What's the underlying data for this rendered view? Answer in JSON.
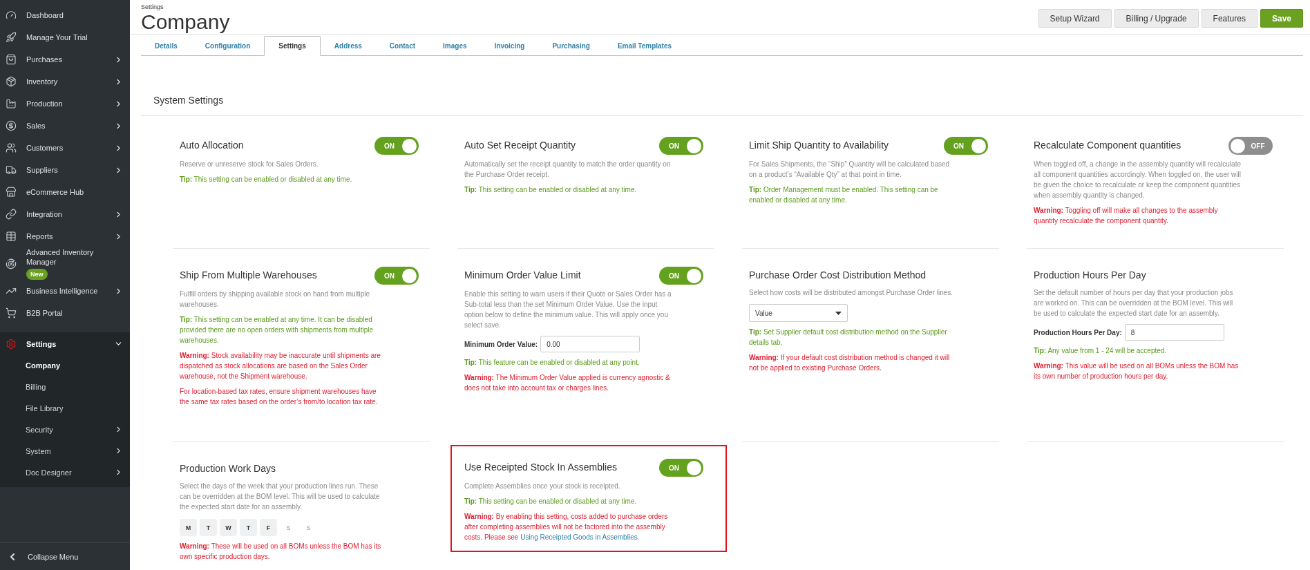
{
  "sidebar": {
    "items": [
      {
        "label": "Dashboard",
        "arrow": false,
        "expanded": false,
        "selected": false
      },
      {
        "label": "Manage Your Trial",
        "arrow": false,
        "expanded": false,
        "selected": false
      },
      {
        "label": "Purchases",
        "arrow": true,
        "expanded": false,
        "selected": false
      },
      {
        "label": "Inventory",
        "arrow": true,
        "expanded": false,
        "selected": false
      },
      {
        "label": "Production",
        "arrow": true,
        "expanded": false,
        "selected": false
      },
      {
        "label": "Sales",
        "arrow": true,
        "expanded": false,
        "selected": false
      },
      {
        "label": "Customers",
        "arrow": true,
        "expanded": false,
        "selected": false
      },
      {
        "label": "Suppliers",
        "arrow": true,
        "expanded": false,
        "selected": false
      },
      {
        "label": "eCommerce Hub",
        "arrow": false,
        "expanded": false,
        "selected": false
      },
      {
        "label": "Integration",
        "arrow": true,
        "expanded": false,
        "selected": false
      },
      {
        "label": "Reports",
        "arrow": true,
        "expanded": false,
        "selected": false
      },
      {
        "label": "Advanced Inventory Manager",
        "badge": "New",
        "arrow": false,
        "expanded": false,
        "selected": false
      },
      {
        "label": "Business Intelligence",
        "arrow": true,
        "expanded": false,
        "selected": false
      },
      {
        "label": "B2B Portal",
        "arrow": false,
        "expanded": false,
        "selected": false
      },
      {
        "label": "Settings",
        "arrow": true,
        "expanded": true,
        "selected": true,
        "children": [
          {
            "label": "Company",
            "arrow": false,
            "selected": true
          },
          {
            "label": "Billing",
            "arrow": false,
            "selected": false
          },
          {
            "label": "File Library",
            "arrow": false,
            "selected": false
          },
          {
            "label": "Security",
            "arrow": true,
            "selected": false
          },
          {
            "label": "System",
            "arrow": true,
            "selected": false
          },
          {
            "label": "Doc Designer",
            "arrow": true,
            "selected": false
          }
        ]
      }
    ],
    "collapse": "Collapse Menu"
  },
  "header": {
    "breadcrumb": "Settings",
    "title": "Company",
    "buttons": [
      {
        "label": "Setup Wizard",
        "kind": "default"
      },
      {
        "label": "Billing / Upgrade",
        "kind": "default"
      },
      {
        "label": "Features",
        "kind": "default"
      },
      {
        "label": "Save",
        "kind": "primary"
      }
    ]
  },
  "tabs": [
    {
      "label": "Details",
      "selected": false
    },
    {
      "label": "Configuration",
      "selected": false
    },
    {
      "label": "Settings",
      "selected": true
    },
    {
      "label": "Address",
      "selected": false
    },
    {
      "label": "Contact",
      "selected": false
    },
    {
      "label": "Images",
      "selected": false
    },
    {
      "label": "Invoicing",
      "selected": false
    },
    {
      "label": "Purchasing",
      "selected": false
    },
    {
      "label": "Email Templates",
      "selected": false
    }
  ],
  "section_title": "System Settings",
  "settings": [
    {
      "title": "Auto Allocation",
      "toggle": {
        "on": true,
        "label": "ON"
      },
      "description": "Reserve or unreserve stock for Sales Orders.",
      "highlighted": false,
      "tip": {
        "label": "Tip:",
        "text": "This setting can be enabled or disabled at any time."
      }
    },
    {
      "title": "Auto Set Receipt Quantity",
      "toggle": {
        "on": true,
        "label": "ON"
      },
      "description": "Automatically set the receipt quantity to match the order quantity on the Purchase Order receipt.",
      "highlighted": false,
      "tip": {
        "label": "Tip:",
        "text": "This setting can be enabled or disabled at any time."
      }
    },
    {
      "title": "Limit Ship Quantity to Availability",
      "toggle": {
        "on": true,
        "label": "ON"
      },
      "description": "For Sales Shipments, the “Ship” Quantity will be calculated based on a product’s “Available Qty” at that point in time.",
      "highlighted": false,
      "tip": {
        "label": "Tip:",
        "text": "Order Management must be enabled. This setting can be enabled or disabled at any time."
      }
    },
    {
      "title": "Recalculate Component quantities",
      "toggle": {
        "on": false,
        "label": "OFF"
      },
      "description": "When toggled off, a change in the assembly quantity will recalculate all component quantities accordingly. When toggled on, the user will be given the choice to recalculate or keep the component quantities when assembly quantity is changed.",
      "highlighted": false,
      "warnings": [
        {
          "label": "Warning:",
          "text": "Toggling off will make all changes to the assembly quantity recalculate the component quantity."
        }
      ]
    },
    {
      "title": "Ship From Multiple Warehouses",
      "toggle": {
        "on": true,
        "label": "ON"
      },
      "description": "Fulfill orders by shipping available stock on hand from multiple warehouses.",
      "highlighted": false,
      "tip": {
        "label": "Tip:",
        "text": "This setting can be enabled at any time. It can be disabled provided there are no open orders with shipments from multiple warehouses."
      },
      "warnings": [
        {
          "label": "Warning:",
          "text": "Stock availability may be inaccurate until shipments are dispatched as stock allocations are based on the Sales Order warehouse, not the Shipment warehouse."
        },
        {
          "text": "For location-based tax rates, ensure shipment warehouses have the same tax rates based on the order’s from/to location tax rate."
        }
      ]
    },
    {
      "title": "Minimum Order Value Limit",
      "toggle": {
        "on": true,
        "label": "ON"
      },
      "description": "Enable this setting to warn users if their Quote or Sales Order has a Sub-total less than the set Minimum Order Value. Use the input option below to define the minimum value. This will apply once you select save.",
      "highlighted": false,
      "control": {
        "kind": "field",
        "label": "Minimum Order Value:",
        "value": "0.00"
      },
      "tip": {
        "label": "Tip:",
        "text": "This feature can be enabled or disabled at any point."
      },
      "warnings": [
        {
          "label": "Warning:",
          "text": "The Minimum Order Value applied is currency agnostic & does not take into account tax or charges lines."
        }
      ]
    },
    {
      "title": "Purchase Order Cost Distribution Method",
      "description": "Select how costs will be distributed amongst Purchase Order lines.",
      "highlighted": false,
      "control": {
        "kind": "select",
        "value": "Value"
      },
      "tip": {
        "label": "Tip:",
        "text": "Set Supplier default cost distribution method on the Supplier details tab."
      },
      "warnings": [
        {
          "label": "Warning:",
          "text": "If your default cost distribution method is changed it will not be applied to existing Purchase Orders."
        }
      ]
    },
    {
      "title": "Production Hours Per Day",
      "description": "Set the default number of hours per day that your production jobs are worked on. This can be overridden at the BOM level. This will be used to calculate the expected start date for an assembly.",
      "highlighted": false,
      "control": {
        "kind": "field",
        "label": "Production Hours Per Day:",
        "value": "8"
      },
      "tip": {
        "label": "Tip:",
        "text": "Any value from 1 - 24 will be accepted."
      },
      "warnings": [
        {
          "label": "Warning:",
          "text": "This value will be used on all BOMs unless the BOM has its own number of production hours per day."
        }
      ]
    },
    {
      "title": "Production Work Days",
      "description": "Select the days of the week that your production lines run. These can be overridden at the BOM level. This will be used to calculate the expected start date for an assembly.",
      "highlighted": false,
      "control": {
        "kind": "days",
        "days": [
          {
            "label": "M",
            "selected": true
          },
          {
            "label": "T",
            "selected": true
          },
          {
            "label": "W",
            "selected": true
          },
          {
            "label": "T",
            "selected": true
          },
          {
            "label": "F",
            "selected": true
          },
          {
            "label": "S",
            "selected": false
          },
          {
            "label": "S",
            "selected": false
          }
        ]
      },
      "warnings": [
        {
          "label": "Warning:",
          "text": "These will be used on all BOMs unless the BOM has its own specific production days."
        }
      ]
    },
    {
      "title": "Use Receipted Stock In Assemblies",
      "toggle": {
        "on": true,
        "label": "ON"
      },
      "description": "Complete Assemblies once your stock is receipted.",
      "highlighted": true,
      "tip": {
        "label": "Tip:",
        "text": "This setting can be enabled or disabled at any time."
      },
      "warnings": [
        {
          "label": "Warning:",
          "text": "By enabling this setting, costs added to purchase orders after completing assemblies will not be factored into the assembly costs. Please see",
          "link": "Using Receipted Goods in Assemblies",
          "after": "."
        }
      ]
    }
  ]
}
